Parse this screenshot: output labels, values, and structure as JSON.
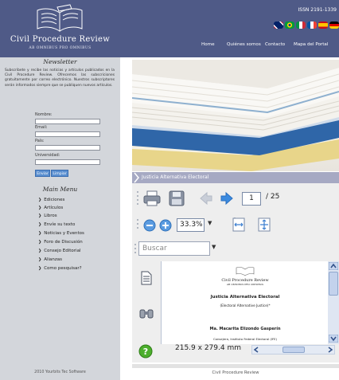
{
  "header": {
    "issn": "ISSN 2191-1339",
    "nav": [
      "Home",
      "Quiénes somos",
      "Contacto",
      "Mapa del Portal"
    ]
  },
  "logo": {
    "title": "Civil Procedure Review",
    "subtitle": "AB OMNIBUS PRO OMNIBUS"
  },
  "newsletter": {
    "title": "Newsletter",
    "text": "Subscribete y recibe las noticias y artículos publicados en la Civil Procedure Review. Ofrecemos las subscriciones gratuitamente por correo electrónico. Nuestros subscriptores serán informados siempre que se publiquen nuevos artículos.",
    "fields": {
      "nombre": "Nombre:",
      "email": "Email:",
      "pais": "País:",
      "universidad": "Universidad:"
    },
    "send_button": "Enviar",
    "clear_button": "Limpiar"
  },
  "main_menu": {
    "title": "Main Menu",
    "items": [
      "Ediciones",
      "Artículos",
      "Libros",
      "Envíe su texto",
      "Noticias y Eventos",
      "Foro de Discusión",
      "Consejo Editorial",
      "Alianzas",
      "Como pesquisar?"
    ]
  },
  "left_footer": "2010 Yourbits Tec Software",
  "article": {
    "title": "Justicia Alternativa Electoral"
  },
  "viewer": {
    "current_page": "1",
    "total_pages": "/ 25",
    "zoom": "33.3%",
    "search_placeholder": "Buscar",
    "page_size": "215.9 x 279.4 mm",
    "doc": {
      "journal": "Civil Procedure Review",
      "journal_sub": "AB OMNIBUS PRO OMNIBUS",
      "title": "Justicia Alternativa Electoral",
      "subtitle": "(Electoral Alternative Justice)*",
      "author": "Ma. Macarita Elizondo Gasperín",
      "affiliation": "Consejera, Instituto Federal Electoral (IFE)"
    }
  },
  "site_footer": "Civil Procedure Review",
  "colors": {
    "header_bg": "#4f5a87",
    "sidebar_bg": "#d3d6db",
    "article_bar": "#a6a9c3",
    "button_blue": "#5a8fd0"
  }
}
